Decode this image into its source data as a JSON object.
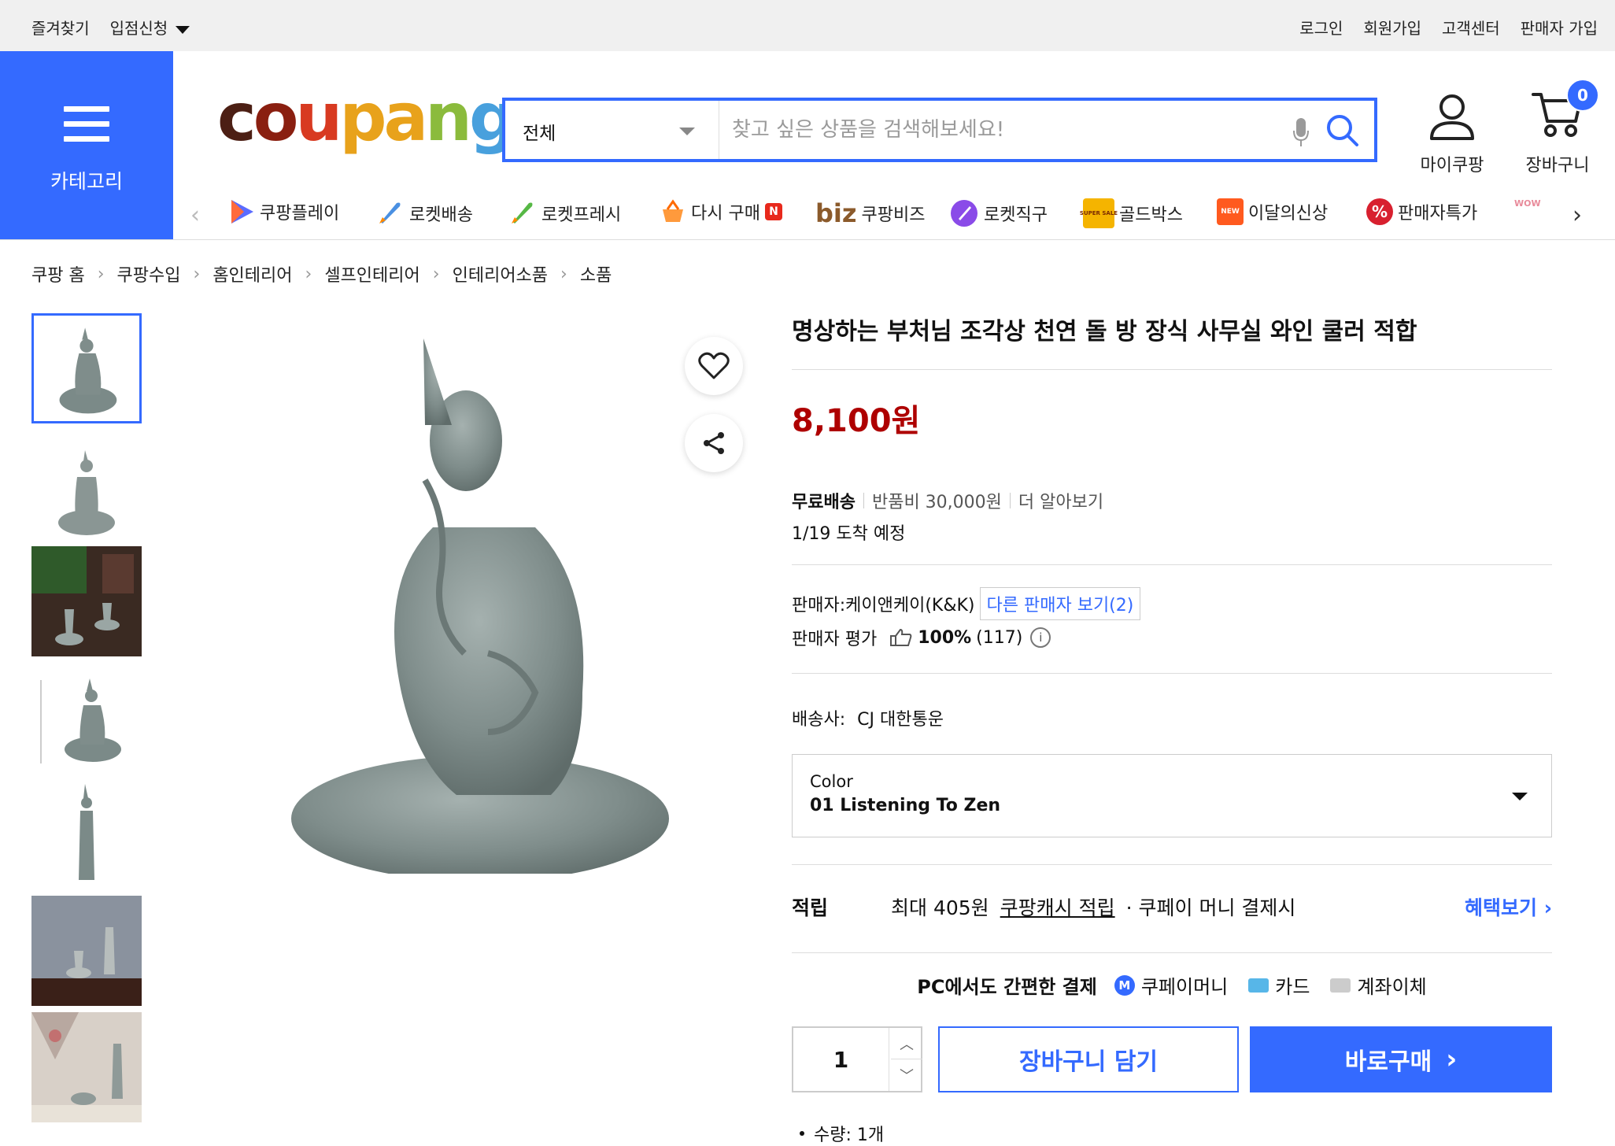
{
  "topbar": {
    "favorites": "즐겨찾기",
    "store_apply": "입점신청",
    "login": "로그인",
    "signup": "회원가입",
    "customer_center": "고객센터",
    "seller_signup": "판매자 가입"
  },
  "header": {
    "category_label": "카테고리",
    "logo_text": "coupang",
    "search_scope": "전체",
    "search_placeholder": "찾고 싶은 상품을 검색해보세요!",
    "my_coupang": "마이쿠팡",
    "cart": "장바구니",
    "cart_count": "0"
  },
  "shortcuts": [
    "쿠팡플레이",
    "로켓배송",
    "로켓프레시",
    "다시 구매",
    "쿠팡비즈",
    "로켓직구",
    "골드박스",
    "이달의신상",
    "판매자특가"
  ],
  "shortcut_extra": {
    "biz_prefix": "biz",
    "rebuy_badge": "N",
    "goldbox_badge": "SUPER SALE",
    "new_badge": "NEW",
    "wow_label": "WOW"
  },
  "breadcrumb": [
    "쿠팡 홈",
    "쿠팡수입",
    "홈인테리어",
    "셀프인테리어",
    "인테리어소품",
    "소품"
  ],
  "product": {
    "title": "명상하는 부처님 조각상 천연 돌 방 장식 사무실 와인 쿨러 적합",
    "price": "8,100원",
    "free_shipping": "무료배송",
    "return_fee": "반품비 30,000원",
    "learn_more": "더 알아보기",
    "arrival": "1/19 도착 예정",
    "seller": "판매자:케이앤케이(K&K)",
    "other_sellers": "다른 판매자 보기(2)",
    "seller_rating_label": "판매자 평가",
    "seller_rating_value": "100%",
    "seller_rating_count": "(117)",
    "courier_label": "배송사:",
    "courier": "CJ 대한통운",
    "option_key": "Color",
    "option_value": "01 Listening To Zen",
    "reward_label": "적립",
    "reward_amount": "최대 405원",
    "reward_link": "쿠팡캐시 적립",
    "reward_cond": "· 쿠페이 머니 결제시",
    "reward_more": "혜택보기 ›",
    "pay_title": "PC에서도 간편한 결제",
    "pay_money": "쿠페이머니",
    "pay_card": "카드",
    "pay_transfer": "계좌이체",
    "quantity": "1",
    "add_to_cart": "장바구니 담기",
    "buy_now": "바로구매",
    "qty_note": "수량: 1개"
  },
  "colors": {
    "brand_blue": "#346aff",
    "price_red": "#ae0000"
  }
}
